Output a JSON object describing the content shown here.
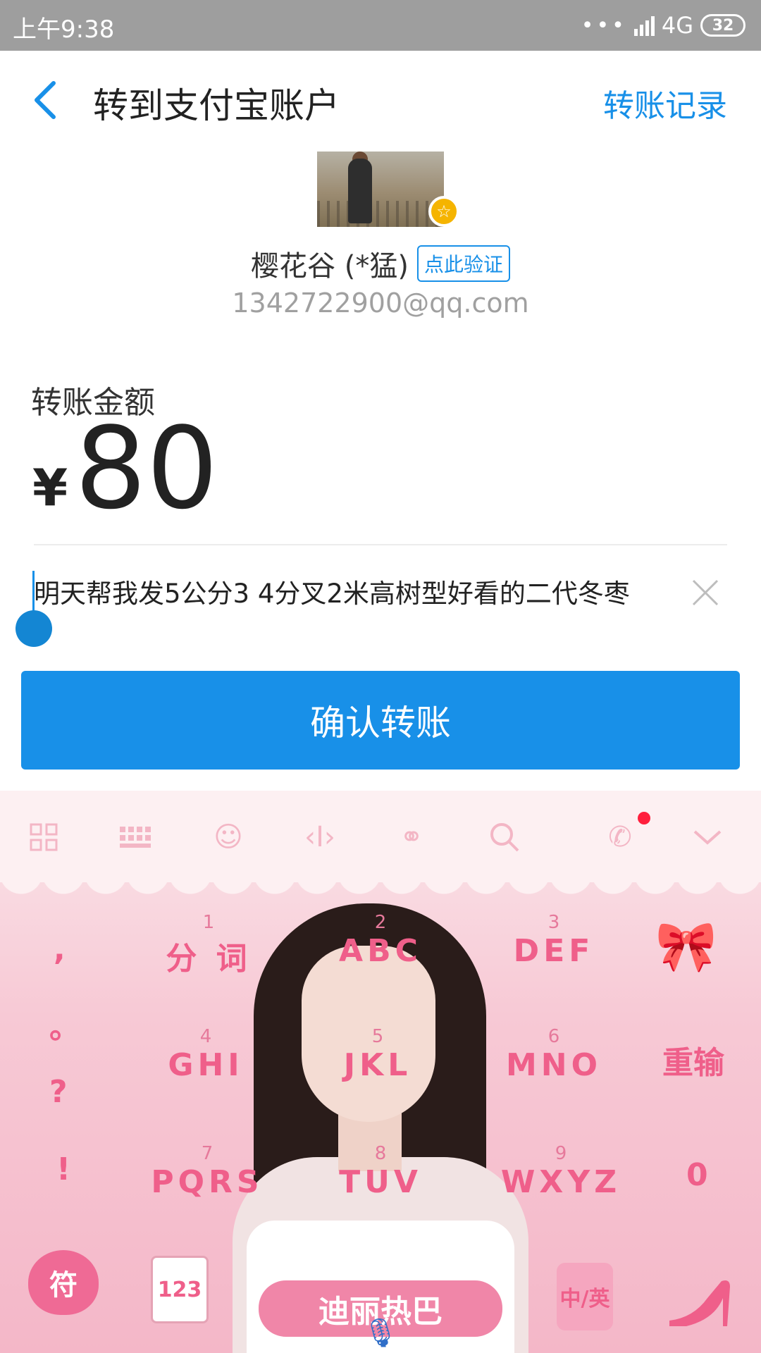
{
  "status_bar": {
    "time": "上午9:38",
    "signal_dots": "•••",
    "network": "4G",
    "battery": "32"
  },
  "header": {
    "title": "转到支付宝账户",
    "records_link": "转账记录"
  },
  "recipient": {
    "name": "樱花谷 (*猛)",
    "verify_label": "点此验证",
    "account": "1342722900@qq.com"
  },
  "amount": {
    "label": "转账金额",
    "currency": "¥",
    "value": "80"
  },
  "note": {
    "value": "明天帮我发5公分3  4分叉2米高树型好看的二代冬枣"
  },
  "confirm_button": {
    "label": "确认转账"
  },
  "keyboard": {
    "toolbar_icons": [
      "grid-icon",
      "keyboard-icon",
      "emoji-icon",
      "cursor-icon",
      "link-icon",
      "search-icon",
      "phone-icon",
      "chevron-down-icon"
    ],
    "keys": {
      "k1": {
        "num": "1",
        "txt": "分 词"
      },
      "k2": {
        "num": "2",
        "txt": "ABC"
      },
      "k3": {
        "num": "3",
        "txt": "DEF"
      },
      "k4": {
        "num": "4",
        "txt": "GHI"
      },
      "k5": {
        "num": "5",
        "txt": "JKL"
      },
      "k6": {
        "num": "6",
        "txt": "MNO"
      },
      "k7": {
        "num": "7",
        "txt": "PQRS"
      },
      "k8": {
        "num": "8",
        "txt": "TUV"
      },
      "k9": {
        "num": "9",
        "txt": "WXYZ"
      }
    },
    "punct": [
      ",",
      "。",
      "?",
      "!"
    ],
    "reinput": "重输",
    "zero": "0",
    "symbol": "符",
    "numbers": "123",
    "banner": "迪丽热巴",
    "lang": "中/英",
    "accent_color": "#ef5f8a"
  }
}
